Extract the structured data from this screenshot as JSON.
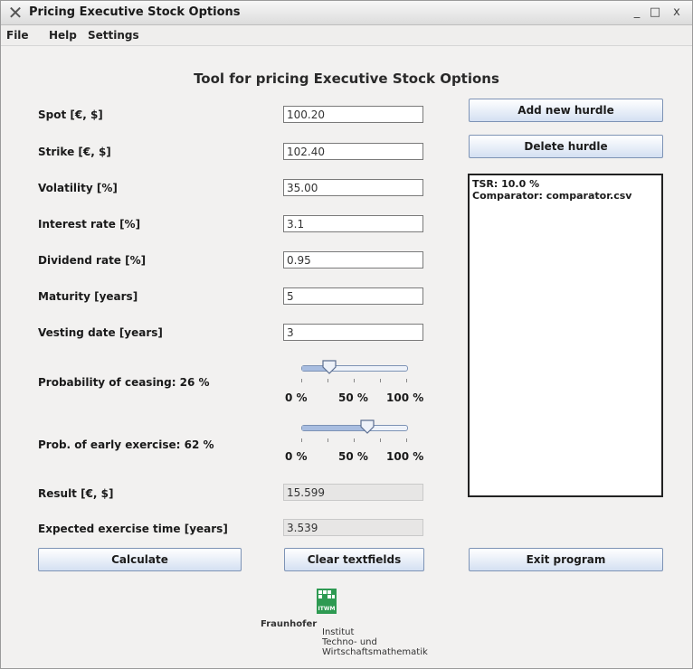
{
  "window": {
    "title": "Pricing Executive Stock Options",
    "controls": {
      "minimize": "_",
      "maximize": "□",
      "close": "x"
    }
  },
  "menu": {
    "items": [
      "File",
      "Help",
      "Settings"
    ]
  },
  "heading": "Tool for pricing Executive Stock Options",
  "form": {
    "spot": {
      "label": "Spot [€, $]",
      "value": "100.20"
    },
    "strike": {
      "label": "Strike [€, $]",
      "value": "102.40"
    },
    "volatility": {
      "label": "Volatility [%]",
      "value": "35.00"
    },
    "interest": {
      "label": "Interest rate [%]",
      "value": "3.1"
    },
    "dividend": {
      "label": "Dividend rate [%]",
      "value": "0.95"
    },
    "maturity": {
      "label": "Maturity [years]",
      "value": "5"
    },
    "vesting": {
      "label": "Vesting date [years]",
      "value": "3"
    }
  },
  "sliders": {
    "ceasing": {
      "label": "Probability of ceasing: 26 %",
      "value_percent": 26
    },
    "early": {
      "label": "Prob. of  early exercise: 62 %",
      "value_percent": 62
    },
    "ticks": [
      "0 %",
      "50 %",
      "100 %"
    ]
  },
  "results": {
    "result": {
      "label": "Result [€, $]",
      "value": "15.599"
    },
    "exercise_time": {
      "label": "Expected exercise time [years]",
      "value": "3.539"
    }
  },
  "buttons": {
    "add_hurdle": "Add new hurdle",
    "delete_hurdle": "Delete hurdle",
    "calculate": "Calculate",
    "clear": "Clear textfields",
    "exit": "Exit program"
  },
  "hurdles_panel": {
    "lines": [
      "TSR: 10.0 %",
      "Comparator: comparator.csv"
    ]
  },
  "logo": {
    "brand": "Fraunhofer",
    "lines": [
      "Institut",
      "Techno- und",
      "Wirtschaftsmathematik"
    ],
    "badge": "ITWM",
    "color": "#2e9a52"
  }
}
